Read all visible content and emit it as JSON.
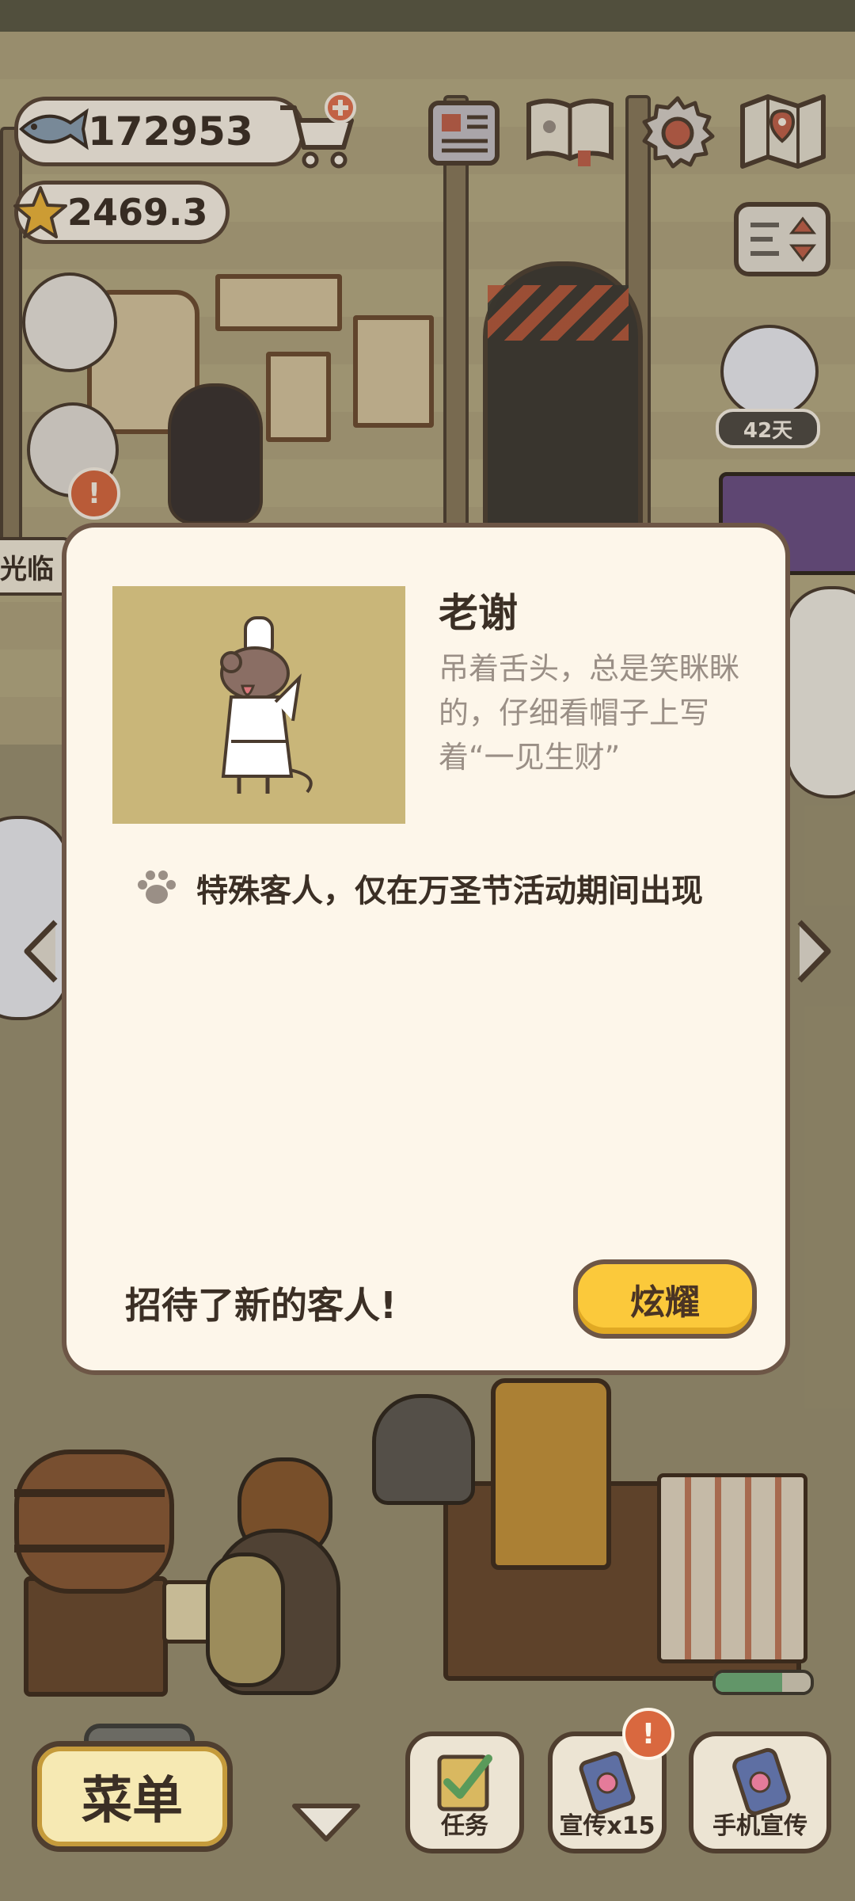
{
  "hud": {
    "fish_count": "172953",
    "star_count": "2469.3",
    "day_badge": "42天",
    "welcome_sign": "光临"
  },
  "modal": {
    "guest_name": "老谢",
    "guest_description": "吊着舌头，总是笑眯眯的，仔细看帽子上写着“一见生财”",
    "note": "特殊客人，仅在万圣节活动期间出现",
    "footer": "招待了新的客人!",
    "flaunt_label": "炫耀"
  },
  "bottom_bar": {
    "menu_label": "菜单",
    "task_label": "任务",
    "promo_label": "宣传x15",
    "phone_promo_label": "手机宣传",
    "alert_mark": "!"
  },
  "progress": {
    "fill_fraction": 0.7
  },
  "colors": {
    "modal_bg": "#fdf6ea",
    "button_yellow": "#fbc93b",
    "text_dark": "#3b2f25",
    "text_muted": "#9a8f86",
    "alert_orange": "#d9683f"
  },
  "icons": [
    "fish-icon",
    "star-icon",
    "cart-plus-icon",
    "newspaper-icon",
    "guestbook-icon",
    "gear-icon",
    "map-icon",
    "sort-icon",
    "paw-icon",
    "checklist-icon",
    "promo-card-icon",
    "phone-icon",
    "chevron-down-icon",
    "chevron-left-icon",
    "chevron-right-icon"
  ]
}
